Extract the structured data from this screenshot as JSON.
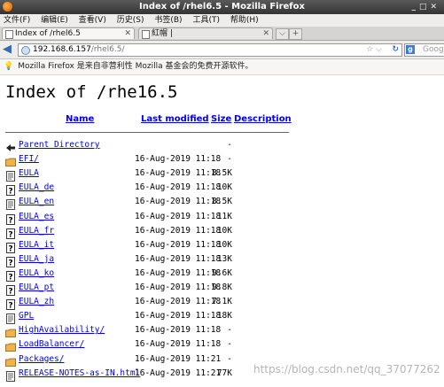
{
  "window": {
    "title": "Index of /rhel6.5 - Mozilla Firefox"
  },
  "menu": [
    "文件(F)",
    "编辑(E)",
    "查看(V)",
    "历史(S)",
    "书签(B)",
    "工具(T)",
    "帮助(H)"
  ],
  "tabs": [
    {
      "label": "Index of /rhel6.5",
      "active": true
    },
    {
      "label": "紅帽 |",
      "active": false
    }
  ],
  "nav": {
    "url_host": "192.168.6.157",
    "url_path": "/rhel6.5/",
    "search_placeholder": "Goog"
  },
  "notice": "Mozilla Firefox 是来自非营利性 Mozilla 基金会的免费开源软件。",
  "page": {
    "heading": "Index of /rhe16.5",
    "columns": {
      "name": "Name",
      "modified": "Last modified",
      "size": "Size",
      "description": "Description"
    }
  },
  "listing": [
    {
      "icon": "back-icon",
      "name": "Parent Directory",
      "date": "",
      "size": "-"
    },
    {
      "icon": "folder-icon",
      "name": "EFI/",
      "date": "16-Aug-2019 11:18",
      "size": "-"
    },
    {
      "icon": "text-icon",
      "name": "EULA",
      "date": "16-Aug-2019 11:18",
      "size": "8.5K"
    },
    {
      "icon": "unknown-icon",
      "name": "EULA_de",
      "date": "16-Aug-2019 11:18",
      "size": "10K"
    },
    {
      "icon": "text-icon",
      "name": "EULA_en",
      "date": "16-Aug-2019 11:18",
      "size": "8.5K"
    },
    {
      "icon": "unknown-icon",
      "name": "EULA_es",
      "date": "16-Aug-2019 11:18",
      "size": "11K"
    },
    {
      "icon": "unknown-icon",
      "name": "EULA_fr",
      "date": "16-Aug-2019 11:18",
      "size": "10K"
    },
    {
      "icon": "unknown-icon",
      "name": "EULA_it",
      "date": "16-Aug-2019 11:18",
      "size": "10K"
    },
    {
      "icon": "unknown-icon",
      "name": "EULA_ja",
      "date": "16-Aug-2019 11:18",
      "size": "13K"
    },
    {
      "icon": "unknown-icon",
      "name": "EULA_ko",
      "date": "16-Aug-2019 11:18",
      "size": "9.6K"
    },
    {
      "icon": "unknown-icon",
      "name": "EULA_pt",
      "date": "16-Aug-2019 11:18",
      "size": "9.8K"
    },
    {
      "icon": "unknown-icon",
      "name": "EULA_zh",
      "date": "16-Aug-2019 11:18",
      "size": "7.1K"
    },
    {
      "icon": "text-icon",
      "name": "GPL",
      "date": "16-Aug-2019 11:18",
      "size": "18K"
    },
    {
      "icon": "folder-icon",
      "name": "HighAvailability/",
      "date": "16-Aug-2019 11:18",
      "size": "-"
    },
    {
      "icon": "folder-icon",
      "name": "LoadBalancer/",
      "date": "16-Aug-2019 11:18",
      "size": "-"
    },
    {
      "icon": "folder-icon",
      "name": "Packages/",
      "date": "16-Aug-2019 11:21",
      "size": "-"
    },
    {
      "icon": "text-icon",
      "name": "RELEASE-NOTES-as-IN.html",
      "date": "16-Aug-2019 11:21",
      "size": "77K"
    }
  ],
  "watermark": "https://blog.csdn.net/qq_37077262"
}
